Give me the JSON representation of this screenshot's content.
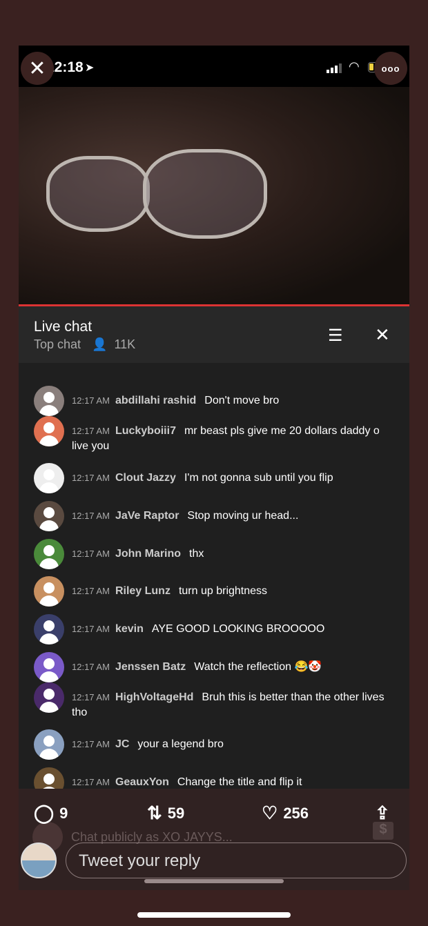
{
  "status_bar": {
    "time": "12:18"
  },
  "chat": {
    "title": "Live chat",
    "mode": "Top chat",
    "viewers": "11K",
    "messages": [
      {
        "time": "12:17 AM",
        "author": "abdillahi rashid",
        "text": "Don't move bro",
        "avatar_color": "#8a7f7c"
      },
      {
        "time": "12:17 AM",
        "author": "Luckyboiii7",
        "text": "mr beast pls give me 20 dollars daddy o live you",
        "avatar_color": "#e07050"
      },
      {
        "time": "12:17 AM",
        "author": "Clout Jazzy",
        "text": "I'm not gonna sub until you flip",
        "avatar_color": "#eeeeee"
      },
      {
        "time": "12:17 AM",
        "author": "JaVe Raptor",
        "text": "Stop moving ur head...",
        "avatar_color": "#5a4a40"
      },
      {
        "time": "12:17 AM",
        "author": "John Marino",
        "text": "thx",
        "avatar_color": "#4a8a3a"
      },
      {
        "time": "12:17 AM",
        "author": "Riley Lunz",
        "text": "turn up brightness",
        "avatar_color": "#c89060"
      },
      {
        "time": "12:17 AM",
        "author": "kevin",
        "text": "AYE GOOD LOOKING BROOOOO",
        "avatar_color": "#3a3f6a"
      },
      {
        "time": "12:17 AM",
        "author": "Jenssen Batz",
        "text": "Watch the reflection 😂🤡",
        "avatar_color": "#7a5ac8"
      },
      {
        "time": "12:17 AM",
        "author": "HighVoltageHd",
        "text": "Bruh this is better than the other lives tho",
        "avatar_color": "#4a2a6a"
      },
      {
        "time": "12:17 AM",
        "author": "JC",
        "text": "your a legend bro",
        "avatar_color": "#8aa0c0"
      },
      {
        "time": "12:17 AM",
        "author": "GeauxYon",
        "text": "Change the title and flip it",
        "avatar_color": "#6a5030"
      }
    ],
    "input_placeholder": "Chat publicly as XO JAYYS..."
  },
  "tweet": {
    "replies": "9",
    "retweets": "59",
    "likes": "256",
    "reply_placeholder": "Tweet your reply"
  },
  "colors": {
    "progress": "#dd3333",
    "background": "#3a2120"
  }
}
